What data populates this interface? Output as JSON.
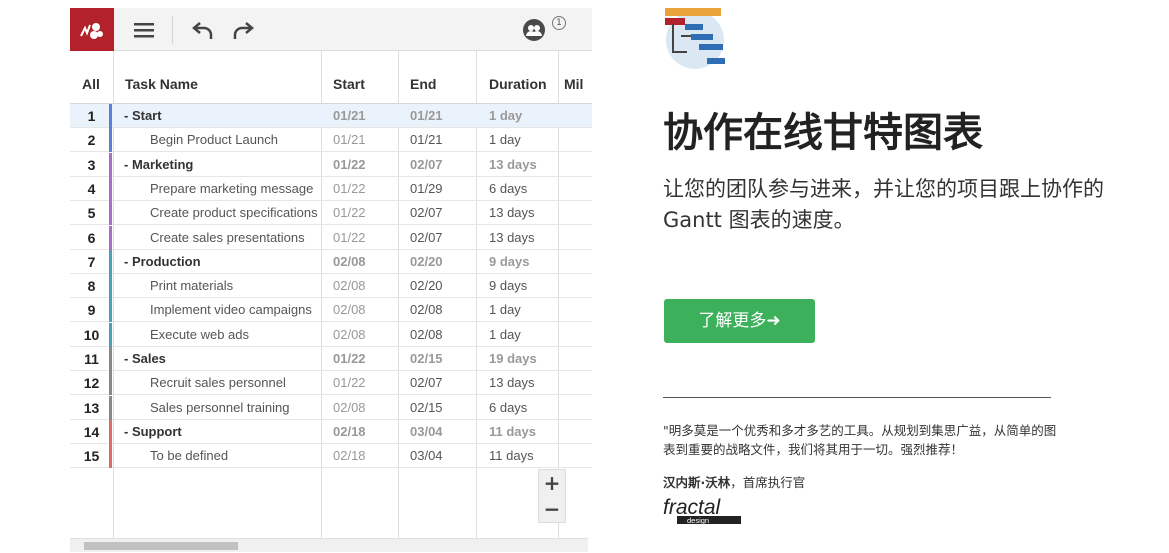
{
  "toolbar": {
    "logo": "app-logo-icon",
    "menu_icon": "hamburger-menu-icon",
    "undo_icon": "undo-icon",
    "redo_icon": "redo-icon",
    "users_icon": "users-icon",
    "users_count": "1",
    "brand_color": "#b3212a"
  },
  "grid": {
    "headers": {
      "all": "All",
      "name": "Task Name",
      "start": "Start",
      "end": "End",
      "duration": "Duration",
      "milestone": "Mil"
    },
    "rows": [
      {
        "num": "1",
        "name": "- Start",
        "start": "01/21",
        "end": "01/21",
        "duration": "1 day",
        "group": true,
        "color": "#5b7fd6"
      },
      {
        "num": "2",
        "name": "Begin Product Launch",
        "start": "01/21",
        "end": "01/21",
        "duration": "1 day",
        "group": false,
        "color": "#5b7fd6"
      },
      {
        "num": "3",
        "name": "- Marketing",
        "start": "01/22",
        "end": "02/07",
        "duration": "13 days",
        "group": true,
        "color": "#a66dc9"
      },
      {
        "num": "4",
        "name": "Prepare marketing message",
        "start": "01/22",
        "end": "01/29",
        "duration": "6 days",
        "group": false,
        "color": "#a66dc9"
      },
      {
        "num": "5",
        "name": "Create product specifications",
        "start": "01/22",
        "end": "02/07",
        "duration": "13 days",
        "group": false,
        "color": "#a66dc9"
      },
      {
        "num": "6",
        "name": "Create sales presentations",
        "start": "01/22",
        "end": "02/07",
        "duration": "13 days",
        "group": false,
        "color": "#a66dc9"
      },
      {
        "num": "7",
        "name": "- Production",
        "start": "02/08",
        "end": "02/20",
        "duration": "9 days",
        "group": true,
        "color": "#4aa0b5"
      },
      {
        "num": "8",
        "name": "Print materials",
        "start": "02/08",
        "end": "02/20",
        "duration": "9 days",
        "group": false,
        "color": "#4aa0b5"
      },
      {
        "num": "9",
        "name": "Implement video campaigns",
        "start": "02/08",
        "end": "02/08",
        "duration": "1 day",
        "group": false,
        "color": "#4aa0b5"
      },
      {
        "num": "10",
        "name": "Execute web ads",
        "start": "02/08",
        "end": "02/08",
        "duration": "1 day",
        "group": false,
        "color": "#4aa0b5"
      },
      {
        "num": "11",
        "name": "- Sales",
        "start": "01/22",
        "end": "02/15",
        "duration": "19 days",
        "group": true,
        "color": "#888888"
      },
      {
        "num": "12",
        "name": "Recruit sales personnel",
        "start": "01/22",
        "end": "02/07",
        "duration": "13 days",
        "group": false,
        "color": "#888888"
      },
      {
        "num": "13",
        "name": "Sales personnel training",
        "start": "02/08",
        "end": "02/15",
        "duration": "6 days",
        "group": false,
        "color": "#888888"
      },
      {
        "num": "14",
        "name": "- Support",
        "start": "02/18",
        "end": "03/04",
        "duration": "11 days",
        "group": true,
        "color": "#e06a6a"
      },
      {
        "num": "15",
        "name": "To be defined",
        "start": "02/18",
        "end": "03/04",
        "duration": "11 days",
        "group": false,
        "color": "#e06a6a"
      }
    ],
    "zoom_in": "+",
    "zoom_out": "−"
  },
  "promo": {
    "icon": "gantt-chart-icon",
    "headline": "协作在线甘特图表",
    "subtitle": "让您的团队参与进来，并让您的项目跟上协作的 Gantt 图表的速度。",
    "cta_label": "了解更多➜",
    "cta_color": "#3cb05a",
    "quote": "\"明多莫是一个优秀和多才多艺的工具。从规划到集思广益，从简单的图表到重要的战略文件，我们将其用于一切。强烈推荐！",
    "author_name": "汉内斯·沃林",
    "author_title": "，首席执行官",
    "brand_logo": "fractal design"
  }
}
